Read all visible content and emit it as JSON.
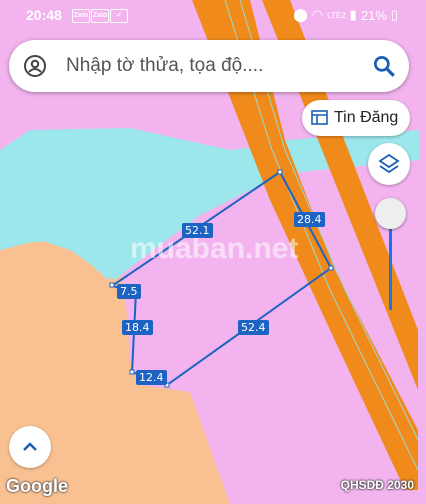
{
  "status": {
    "time": "20:48",
    "apps": [
      "Zalo",
      "Zalo"
    ],
    "battery": "21%",
    "network": "LTE2"
  },
  "search": {
    "placeholder": "Nhập tờ thửa, tọa độ...."
  },
  "buttons": {
    "tin_dang": "Tin Đăng"
  },
  "edges": [
    "52.1",
    "28.4",
    "7.5",
    "18.4",
    "52.4",
    "12.4"
  ],
  "watermark": "muaban.net",
  "footer": {
    "google": "Google",
    "layer": "QHSDĐ 2030"
  },
  "colors": {
    "pink": "#f2b3ef",
    "orange": "#f9c192",
    "road": "#f08a1a",
    "river": "#9be7ec",
    "boundary": "#1d63c3"
  },
  "icons": [
    "account-circle-icon",
    "search-icon",
    "news-icon",
    "layers-icon",
    "chevron-up-icon"
  ]
}
